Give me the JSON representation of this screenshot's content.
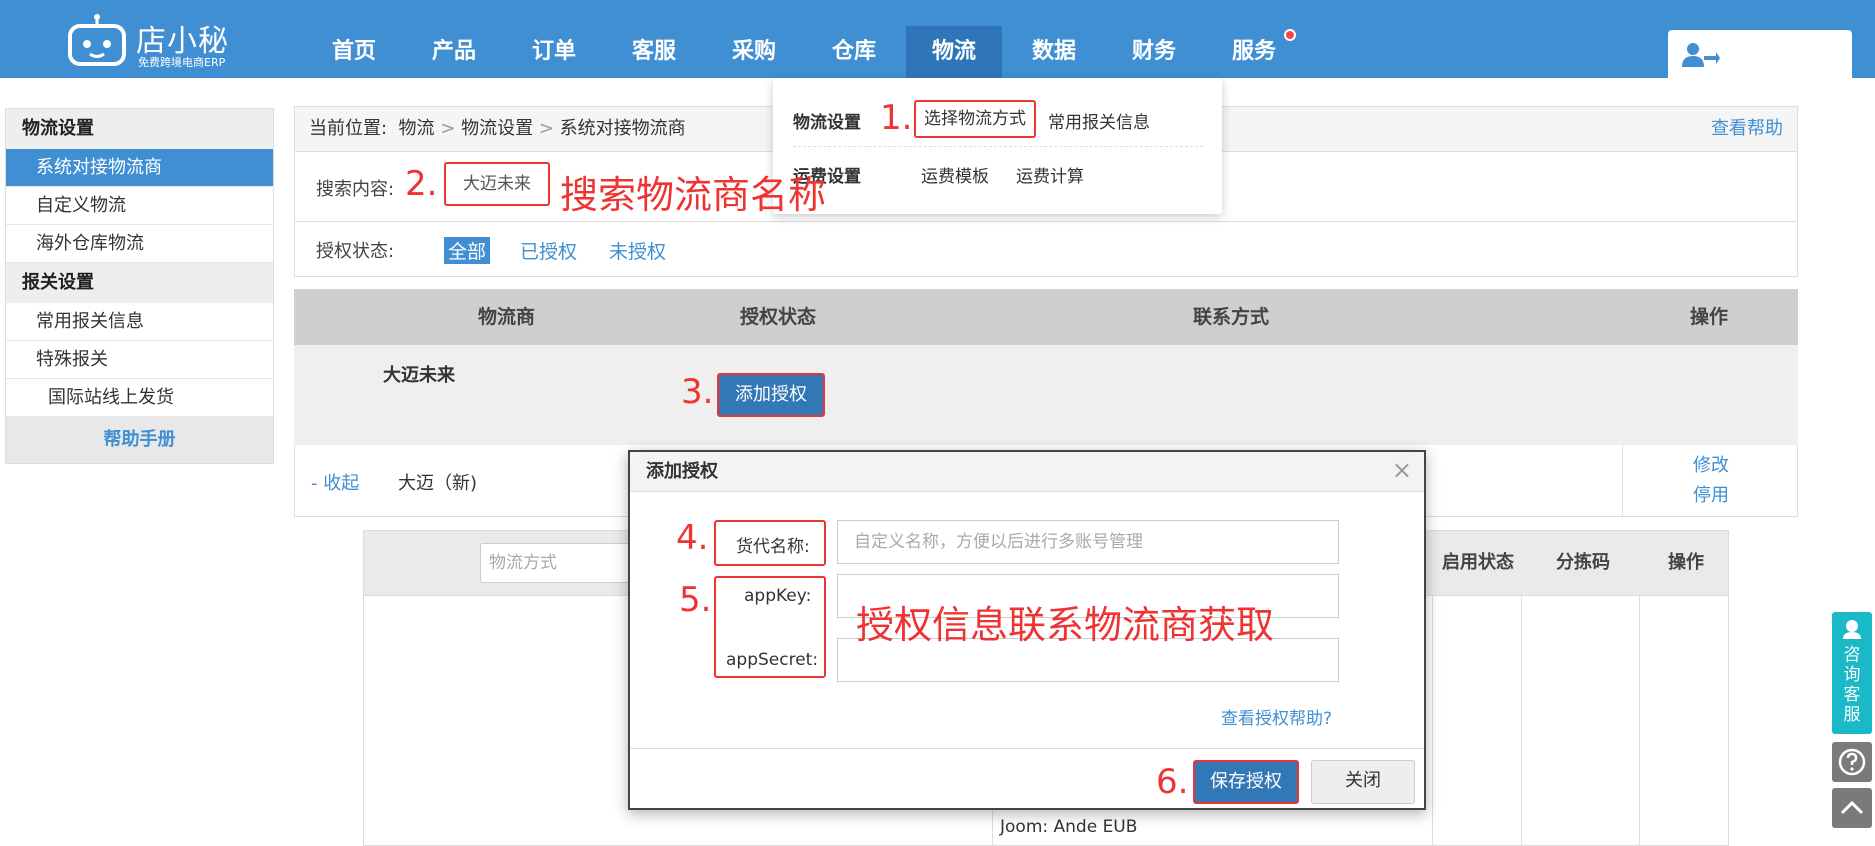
{
  "logo": {
    "brand": "店小秘",
    "slogan": "免费跨境电商ERP"
  },
  "nav": {
    "items": [
      "首页",
      "产品",
      "订单",
      "客服",
      "采购",
      "仓库",
      "物流",
      "数据",
      "财务",
      "服务"
    ],
    "active": "物流"
  },
  "sidebar": {
    "section1": "物流设置",
    "items1": [
      "系统对接物流商",
      "自定义物流",
      "海外仓库物流"
    ],
    "section2": "报关设置",
    "items2": [
      "常用报关信息",
      "特殊报关"
    ],
    "subitem": "国际站线上发货",
    "help": "帮助手册"
  },
  "breadcrumb": {
    "label": "当前位置:",
    "path1": "物流",
    "path2": "物流设置",
    "path3": "系统对接物流商",
    "sep": ">",
    "help": "查看帮助"
  },
  "search": {
    "label": "搜索内容:",
    "value": "大迈未来"
  },
  "auth_filter": {
    "label": "授权状态:",
    "options": [
      "全部",
      "已授权",
      "未授权"
    ]
  },
  "table": {
    "headers": [
      "物流商",
      "授权状态",
      "联系方式",
      "操作"
    ],
    "row": {
      "provider": "大迈未来",
      "button": "添加授权"
    },
    "subrow": {
      "collapse": "- 收起",
      "name": "大迈（新)",
      "edit": "修改",
      "disable": "停用"
    },
    "inner_headers": {
      "placeholder": "物流方式",
      "status": "启用状态",
      "code": "分拣码",
      "op": "操作"
    },
    "inner_cell": "Joom:   Ande EUB"
  },
  "dropdown": {
    "row1_title": "物流设置",
    "row1_items": [
      "选择物流方式",
      "常用报关信息"
    ],
    "row2_title": "运费设置",
    "row2_items": [
      "运费模板",
      "运费计算"
    ]
  },
  "modal": {
    "title": "添加授权",
    "close": "×",
    "label_name": "货代名称:",
    "placeholder_name": "自定义名称，方便以后进行多账号管理",
    "label_key": "appKey:",
    "label_secret": "appSecret:",
    "help": "查看授权帮助?",
    "save": "保存授权",
    "close_btn": "关闭"
  },
  "annotations": {
    "n1": "1.",
    "n2": "2.",
    "n3": "3.",
    "n4": "4.",
    "n5": "5.",
    "n6": "6.",
    "search_note": "搜索物流商名称",
    "auth_note": "授权信息联系物流商获取"
  },
  "floating": {
    "consult": "咨询客服"
  },
  "colors": {
    "primary": "#3f8fd2",
    "annotation": "#e33333",
    "consult": "#19b9c7"
  }
}
